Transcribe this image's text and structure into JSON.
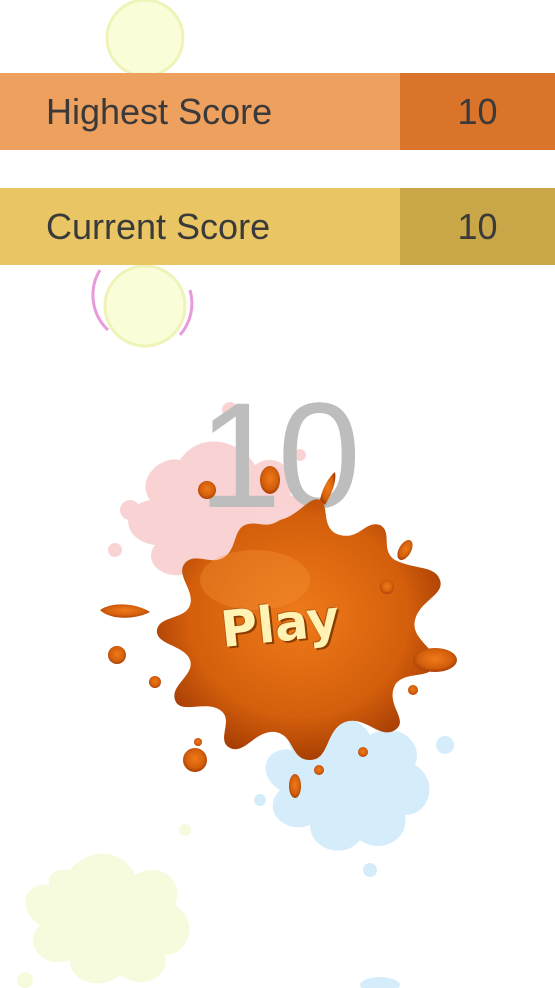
{
  "scores": {
    "highest": {
      "label": "Highest Score",
      "value": "10"
    },
    "current": {
      "label": "Current Score",
      "value": "10"
    }
  },
  "game": {
    "big_number": "10",
    "play_label": "Play"
  },
  "colors": {
    "highest_label_bg": "#eea05f",
    "highest_value_bg": "#d9742a",
    "current_label_bg": "#e9c564",
    "current_value_bg": "#c9a647",
    "splat_orange": "#d45f0c",
    "big_number_gray": "#bdbdbd"
  },
  "icons": {
    "play_button": "paint-splat-icon"
  }
}
